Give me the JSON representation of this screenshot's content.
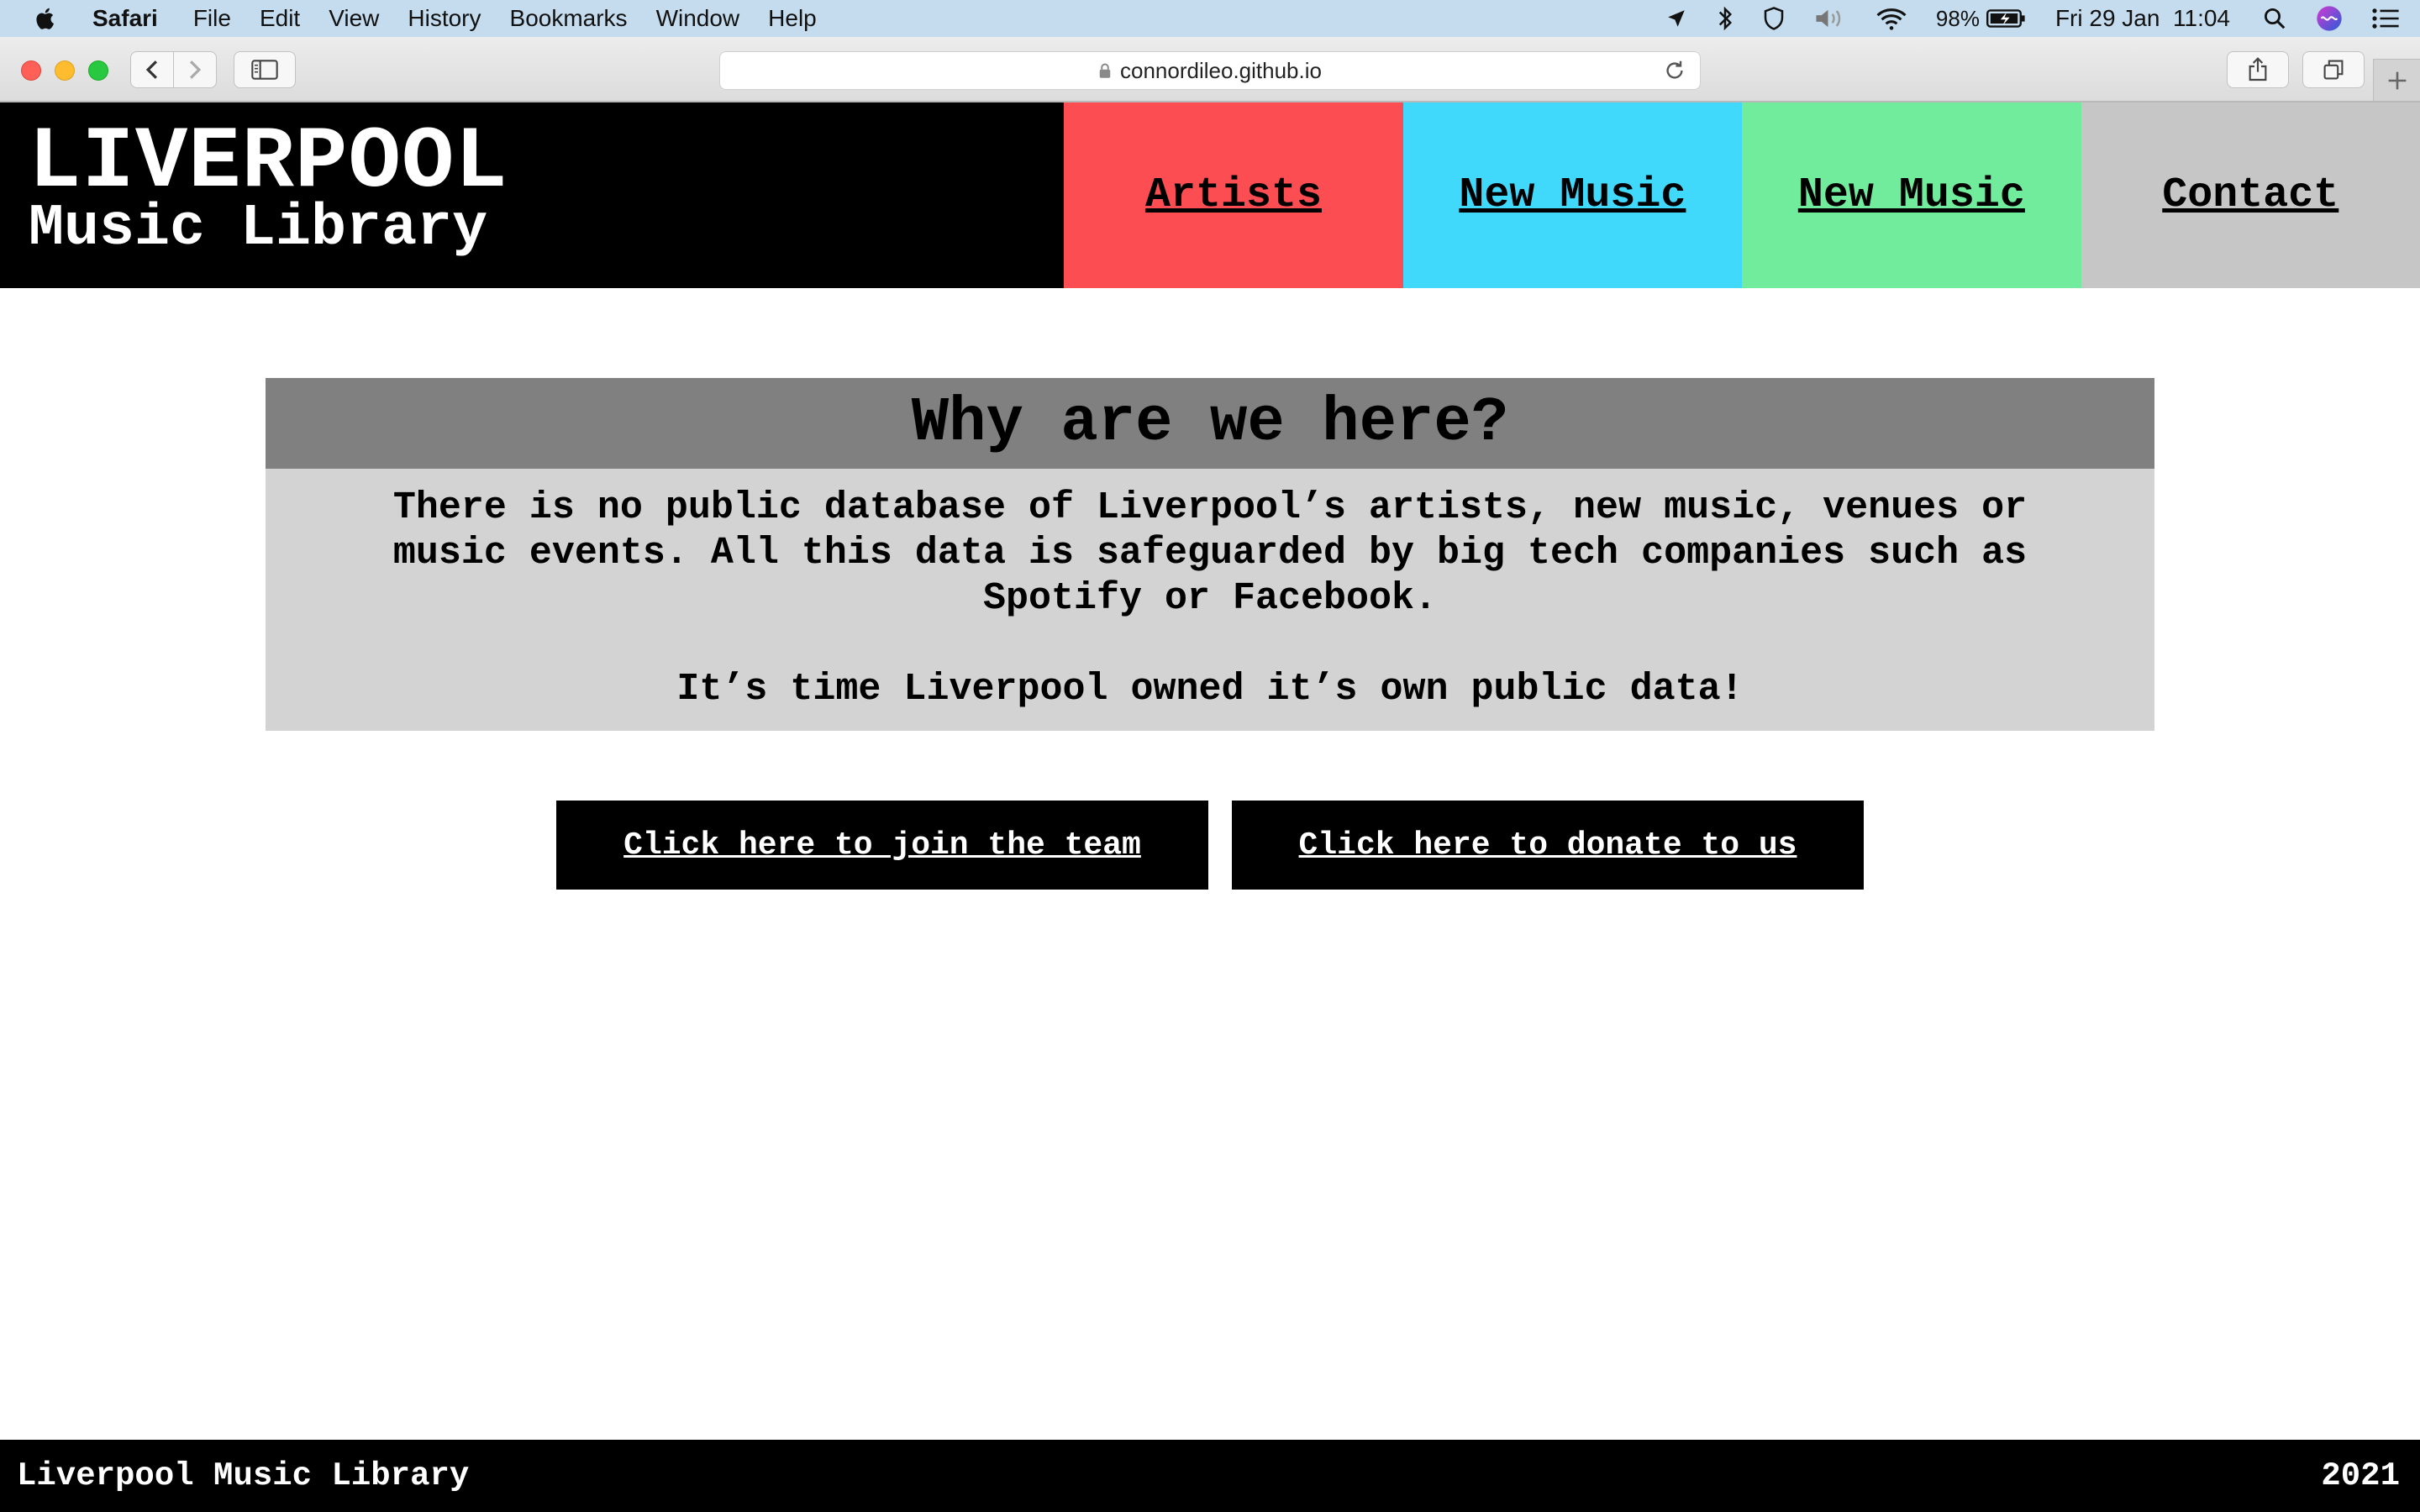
{
  "menubar": {
    "app_name": "Safari",
    "items": [
      "File",
      "Edit",
      "View",
      "History",
      "Bookmarks",
      "Window",
      "Help"
    ],
    "battery": "98%",
    "datetime": "Fri 29 Jan  11:04"
  },
  "browser": {
    "url": "connordileo.github.io"
  },
  "site": {
    "brand_line1": "LIVERPOOL",
    "brand_line2": "Music Library",
    "nav": [
      {
        "label": "Artists",
        "color": "#fc4e52"
      },
      {
        "label": "New Music",
        "color": "#40d8fb"
      },
      {
        "label": "New Music",
        "color": "#71ec9c"
      },
      {
        "label": "Contact",
        "color": "#c6c6c6"
      }
    ],
    "why": {
      "title": "Why are we here?",
      "para1": "There is no public database of Liverpool’s artists, new music, venues or music events. All this data is safeguarded by big tech companies such as Spotify or Facebook.",
      "para2": "It’s time Liverpool owned it’s own public data!"
    },
    "cta_join": "Click here to join the team",
    "cta_donate": "Click here to donate to us",
    "footer_name": "Liverpool Music Library",
    "footer_year": "2021"
  }
}
